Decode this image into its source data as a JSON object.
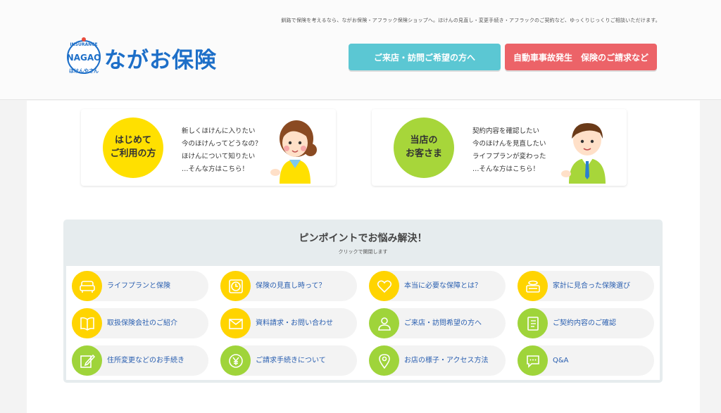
{
  "header": {
    "tagline": "釧路で保険を考えるなら、ながお保険・アフラック保険ショップへ。ほけんの見直し・変更手続き・アフラックのご契約など、ゆっくりじっくりご相談いただけます。",
    "logo_text": "ながお保険",
    "logo_badge_top": "INSURANCE",
    "logo_badge_mid": "NAGAO",
    "logo_badge_bottom": "ほけんやさん",
    "visit_button": "ご来店・訪問ご希望の方へ",
    "claim_button": "自動車事故発生　保険のご請求など"
  },
  "cards": [
    {
      "circle": [
        "はじめて",
        "ご利用の方"
      ],
      "lines": [
        "新しくほけんに入りたい",
        "今のほけんってどうなの？",
        "ほけんについて知りたい",
        "…そんな方はこちら！"
      ]
    },
    {
      "circle": [
        "当店の",
        "お客さま"
      ],
      "lines": [
        "契約内容を確認したい",
        "今のほけんを見直したい",
        "ライフプランが変わった",
        "…そんな方はこちら！"
      ]
    }
  ],
  "pinpoint": {
    "title": "ピンポイントでお悩み解決！",
    "subtitle": "クリックで開閉します",
    "items": [
      {
        "label": "ライフプランと保険",
        "icon": "sofa-icon",
        "color": "yellow"
      },
      {
        "label": "保険の見直し時って？",
        "icon": "clock-icon",
        "color": "yellow"
      },
      {
        "label": "本当に必要な保障とは？",
        "icon": "heart-icon",
        "color": "yellow"
      },
      {
        "label": "家計に見合った保険選び",
        "icon": "coins-icon",
        "color": "yellow"
      },
      {
        "label": "取扱保険会社のご紹介",
        "icon": "book-icon",
        "color": "yellow"
      },
      {
        "label": "資料請求・お問い合わせ",
        "icon": "mail-icon",
        "color": "yellow"
      },
      {
        "label": "ご来店・訪問希望の方へ",
        "icon": "person-icon",
        "color": "green"
      },
      {
        "label": "ご契約内容のご確認",
        "icon": "notebook-icon",
        "color": "green"
      },
      {
        "label": "住所変更などのお手続き",
        "icon": "pencil-icon",
        "color": "green"
      },
      {
        "label": "ご請求手続きについて",
        "icon": "yen-icon",
        "color": "green"
      },
      {
        "label": "お店の様子・アクセス方法",
        "icon": "map-pin-icon",
        "color": "green"
      },
      {
        "label": "Q&A",
        "icon": "chat-icon",
        "color": "green"
      }
    ]
  },
  "colors": {
    "brand_blue": "#1d6fc8",
    "visit_button": "#5bc7d3",
    "claim_button": "#ec6368",
    "yellow": "#ffd400",
    "green": "#9fd43a"
  }
}
